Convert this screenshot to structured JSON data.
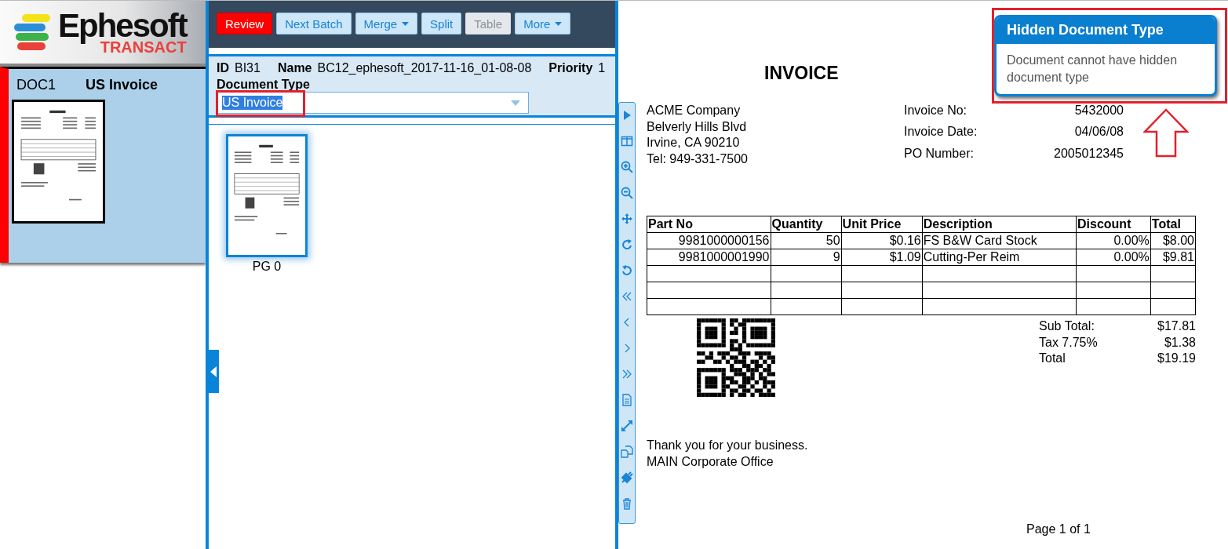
{
  "logo": {
    "name": "Ephesoft",
    "product": "TRANSACT"
  },
  "documents": [
    {
      "id": "DOC1",
      "type": "US Invoice",
      "selected": true
    }
  ],
  "toolbar": [
    {
      "label": "Review",
      "kind": "primary",
      "disabled": false,
      "dropdown": false
    },
    {
      "label": "Next Batch",
      "kind": "normal",
      "disabled": false,
      "dropdown": false
    },
    {
      "label": "Merge",
      "kind": "normal",
      "disabled": false,
      "dropdown": true
    },
    {
      "label": "Split",
      "kind": "normal",
      "disabled": false,
      "dropdown": false
    },
    {
      "label": "Table",
      "kind": "normal",
      "disabled": true,
      "dropdown": false
    },
    {
      "label": "More",
      "kind": "normal",
      "disabled": false,
      "dropdown": true
    }
  ],
  "batch": [
    {
      "label": "ID",
      "value": "BI31"
    },
    {
      "label": "Name",
      "value": "BC12_ephesoft_2017-11-16_01-08-08"
    },
    {
      "label": "Priority",
      "value": "1"
    }
  ],
  "document_type": {
    "label": "Document Type",
    "value": "US Invoice",
    "text_selected": true,
    "annotated": true
  },
  "pages": [
    {
      "label": "PG 0",
      "selected": true
    }
  ],
  "invoice": {
    "title": "INVOICE",
    "from": [
      "ACME Company",
      "Belverly Hills Blvd",
      "Irvine, CA 90210",
      "Tel: 949-331-7500"
    ],
    "meta": [
      {
        "label": "Invoice No:",
        "value": "5432000"
      },
      {
        "label": "Invoice Date:",
        "value": "04/06/08"
      },
      {
        "label": "PO Number:",
        "value": "2005012345"
      }
    ],
    "columns": [
      "Part No",
      "Quantity",
      "Unit Price",
      "Description",
      "Discount",
      "Total"
    ],
    "rows": [
      [
        "9981000000156",
        "50",
        "$0.16",
        "FS B&W Card Stock",
        "0.00%",
        "$8.00"
      ],
      [
        "9981000001990",
        "9",
        "$1.09",
        "Cutting-Per Reim",
        "0.00%",
        "$9.81"
      ]
    ],
    "totals": [
      {
        "label": "Sub Total:",
        "value": "$17.81"
      },
      {
        "label": "Tax 7.75%",
        "value": "$1.38"
      },
      {
        "label": "Total",
        "value": "$19.19"
      }
    ],
    "footer": [
      "Thank you for your business.",
      "MAIN Corporate Office"
    ],
    "page": "Page 1 of 1"
  },
  "tooltip": {
    "title": "Hidden Document Type",
    "message": "Document cannot have hidden document type",
    "annotated": true
  }
}
